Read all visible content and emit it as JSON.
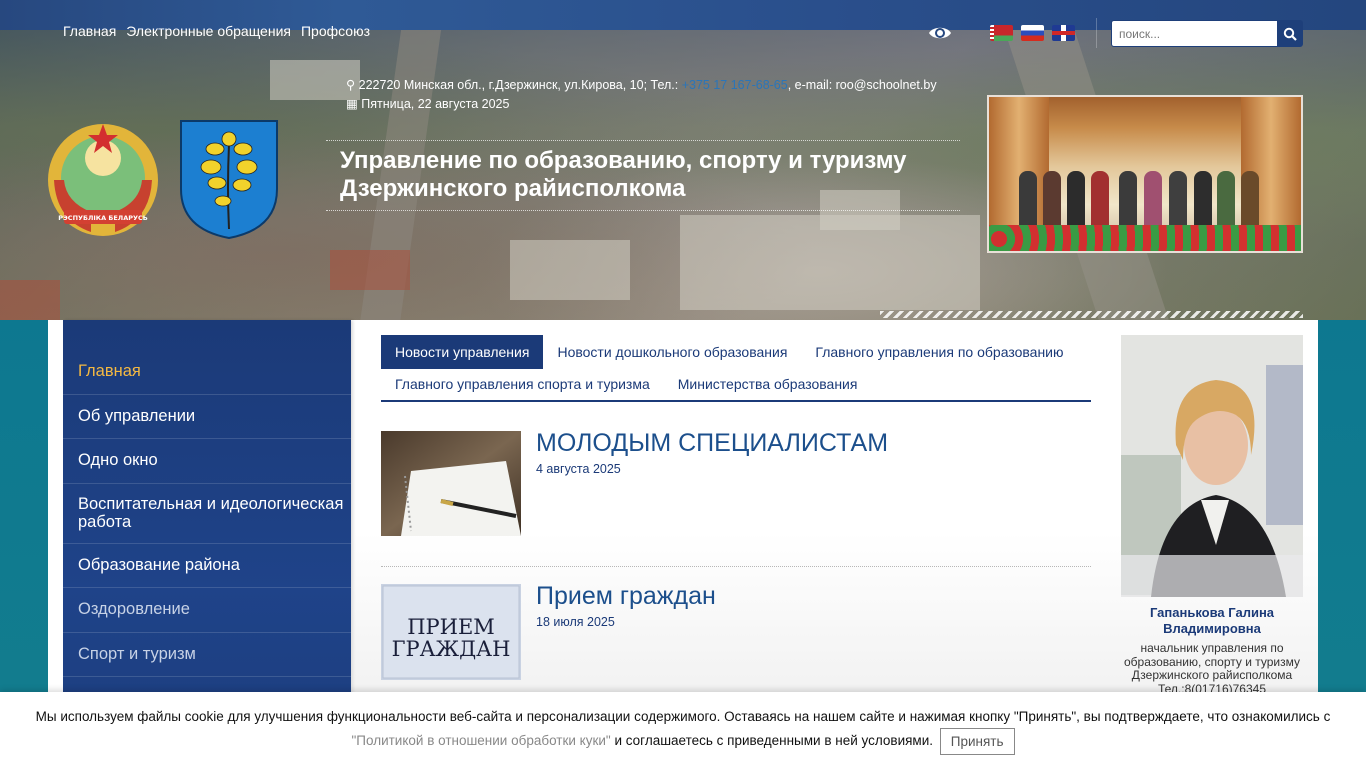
{
  "topnav": {
    "items": [
      "Главная",
      "Электронные обращения",
      "Профсоюз"
    ]
  },
  "accessibility": {
    "icon": "eye-icon"
  },
  "languages": {
    "items": [
      {
        "code": "be",
        "icon": "flag-belarus-icon"
      },
      {
        "code": "ru",
        "icon": "flag-russia-icon"
      },
      {
        "code": "en",
        "icon": "flag-uk-icon"
      }
    ]
  },
  "search": {
    "placeholder": "поиск...",
    "value": "",
    "icon": "search-icon"
  },
  "header": {
    "address_prefix": "222720 Минская обл., г.Дзержинск, ул.Кирова, 10; Тел.: ",
    "phone": "+375 17 167-68-65",
    "email_text": ", e-mail: roo@schoolnet.by",
    "date": "Пятница, 22 августа 2025",
    "title_line1": "Управление по образованию, спорту и туризму",
    "title_line2": "Дзержинского райисполкома",
    "emblem_text": "РЭСПУБЛІКА БЕЛАРУСЬ"
  },
  "sidebar": {
    "items": [
      {
        "label": "Главная"
      },
      {
        "label": "Об управлении"
      },
      {
        "label": "Одно окно"
      },
      {
        "label": "Воспитательная и идеологическая работа"
      },
      {
        "label": "Образование района"
      },
      {
        "label": "Оздоровление"
      },
      {
        "label": "Спорт и туризм"
      }
    ]
  },
  "tabs": {
    "items": [
      {
        "label": "Новости управления"
      },
      {
        "label": "Новости дошкольного образования"
      },
      {
        "label": "Главного управления по образованию"
      },
      {
        "label": "Главного управления спорта и туризма"
      },
      {
        "label": "Министерства образования"
      }
    ]
  },
  "news": [
    {
      "title": "МОЛОДЫМ СПЕЦИАЛИСТАМ",
      "date": "4 августа 2025"
    },
    {
      "title": "Прием граждан",
      "date": "18 июля 2025",
      "thumb_text_1": "ПРИЕМ",
      "thumb_text_2": "ГРАЖДАН"
    }
  ],
  "head": {
    "name": "Гапанькова Галина Владимировна",
    "role_line1": "начальник управления по",
    "role_line2": "образованию, спорту и туризму",
    "role_line3": "Дзержинского райисполкома",
    "role_line4": "Тел.:8(01716)76345"
  },
  "cookie": {
    "text_before": "Мы используем файлы cookie для улучшения функциональности веб-сайта и персонализации содержимого. Оставаясь на нашем сайте и нажимая кнопку \"Принять\", вы подтверждаете, что ознакомились с ",
    "link": "\"Политикой в отношении обработки куки\"",
    "text_after": " и соглашаетесь с приведенными в ней условиями.",
    "accept": "Принять"
  },
  "colors": {
    "primary": "#1b3a78",
    "accent": "#f4b942",
    "link": "#1c4f8c",
    "teal_bg": "#0e6f87"
  }
}
